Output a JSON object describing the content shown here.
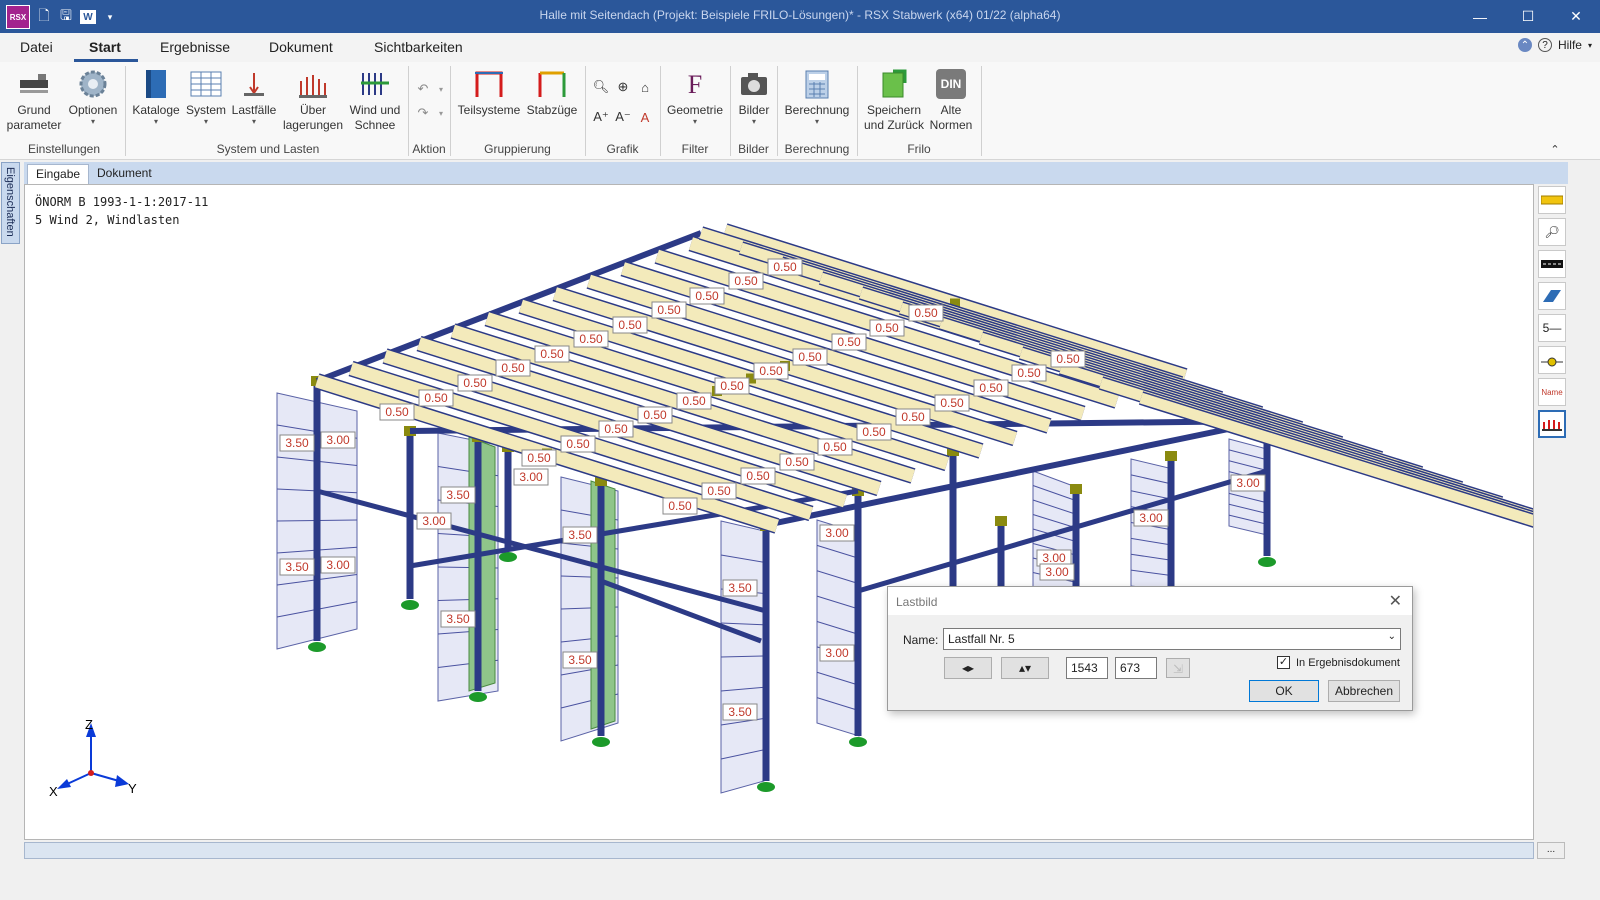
{
  "app": {
    "logo": "RSX",
    "title": "Halle mit Seitendach (Projekt: Beispiele FRILO-Lösungen)* - RSX Stabwerk (x64) 01/22 (alpha64)"
  },
  "menu": {
    "tabs": [
      "Datei",
      "Start",
      "Ergebnisse",
      "Dokument",
      "Sichtbarkeiten"
    ],
    "active": "Start",
    "help": "Hilfe"
  },
  "ribbon": {
    "buttons": {
      "grund": "Grund\nparameter",
      "optionen": "Optionen",
      "kataloge": "Kataloge",
      "system": "System",
      "lastfaelle": "Lastfälle",
      "ueber": "Über\nlagerungen",
      "wind": "Wind und\nSchnee",
      "teilsysteme": "Teilsysteme",
      "stabzuege": "Stabzüge",
      "geometrie": "Geometrie",
      "bilder": "Bilder",
      "berechnung": "Berechnung",
      "speichern": "Speichern\nund Zurück",
      "alte": "Alte\nNormen",
      "din": "DIN"
    },
    "groups": {
      "einstellungen": "Einstellungen",
      "system": "System und Lasten",
      "aktion": "Aktion",
      "gruppierung": "Gruppierung",
      "grafik": "Grafik",
      "filter": "Filter",
      "bilder": "Bilder",
      "berechnung": "Berechnung",
      "frilo": "Frilo"
    }
  },
  "side_tab": "Eigenschaften",
  "doc_tabs": [
    "Eingabe",
    "Dokument"
  ],
  "canvas": {
    "norm": "ÖNORM B 1993-1-1:2017-11",
    "loadcase": "5 Wind 2, Windlasten",
    "axes": {
      "z": "Z",
      "x": "X",
      "y": "Y"
    }
  },
  "load_labels": {
    "roof": "0.50",
    "wall_a": "3.50",
    "wall_b": "3.00"
  },
  "dialog": {
    "title": "Lastbild",
    "name_label": "Name:",
    "name_value": "Lastfall Nr. 5",
    "width": "1543",
    "height": "673",
    "checkbox_label": "In Ergebnisdokument",
    "checkbox_checked": true,
    "ok": "OK",
    "cancel": "Abbrechen"
  },
  "statusbar": {
    "dots": "..."
  },
  "colors": {
    "title_bar": "#2b579a",
    "beam": "#f3eabb",
    "column": "#2c3a86",
    "node": "#8a8a10",
    "support": "#1c9a2a",
    "load_text": "#c0392b"
  }
}
